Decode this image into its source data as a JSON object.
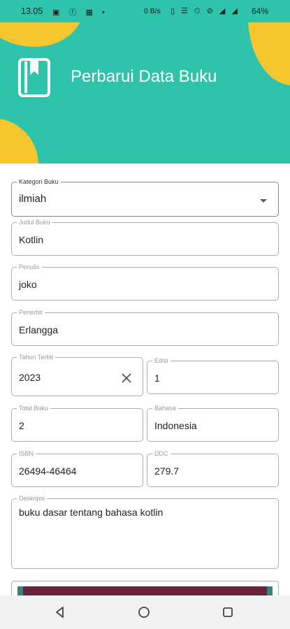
{
  "status_bar": {
    "time": "13.05",
    "notification_icons": "▣ ⓕ ▦ •",
    "net_speed": "0 B/s",
    "system_icons": "▯ ☰ ⏱ ⊘ ◢ ◢",
    "battery": "64%"
  },
  "header": {
    "title": "Perbarui Data Buku",
    "icon": "book-icon"
  },
  "form": {
    "kategori": {
      "label": "Kategori Buku",
      "value": "ilmiah"
    },
    "judul": {
      "label": "Judul Buku",
      "value": "Kotlin"
    },
    "penulis": {
      "label": "Penulis",
      "value": "joko"
    },
    "penerbit": {
      "label": "Penerbit",
      "value": "Erlangga"
    },
    "tahun": {
      "label": "Tahun Terbit",
      "value": "2023"
    },
    "edisi": {
      "label": "Edisi",
      "value": "1"
    },
    "total": {
      "label": "Total Buku",
      "value": "2"
    },
    "bahasa": {
      "label": "Bahasa",
      "value": "Indonesia"
    },
    "isbn": {
      "label": "ISBN",
      "value": "26494-46464"
    },
    "ddc": {
      "label": "DDC",
      "value": "279.7"
    },
    "deskripsi": {
      "label": "Deskripsi",
      "value": "buku dasar tentang bahasa kotlin"
    }
  },
  "colors": {
    "header_bg": "#2ec4ab",
    "accent_blob": "#f7c52e",
    "nav_bg": "#f2f2f2"
  },
  "navigation": {
    "back": "back-icon",
    "home": "home-icon",
    "recents": "recents-icon"
  }
}
